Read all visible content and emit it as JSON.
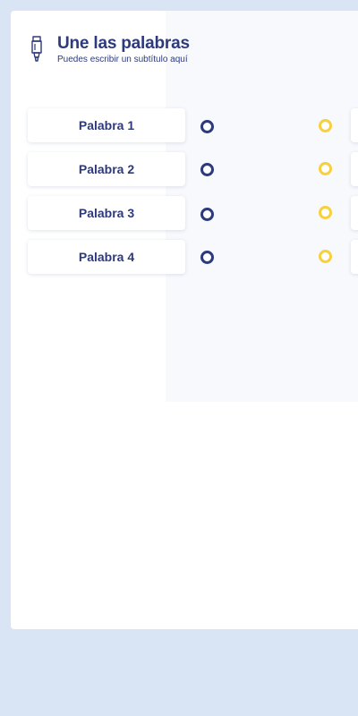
{
  "header": {
    "icon": "marker-icon",
    "title": "Une las palabras",
    "subtitle": "Puedes escribir un subtítulo aquí"
  },
  "left_words": [
    {
      "label": "Palabra 1"
    },
    {
      "label": "Palabra 2"
    },
    {
      "label": "Palabra 3"
    },
    {
      "label": "Palabra 4"
    }
  ],
  "colors": {
    "page_bg": "#d9e4f5",
    "primary": "#2d3a7b",
    "accent": "#f7d03b",
    "tint": "#f8f9fd"
  }
}
